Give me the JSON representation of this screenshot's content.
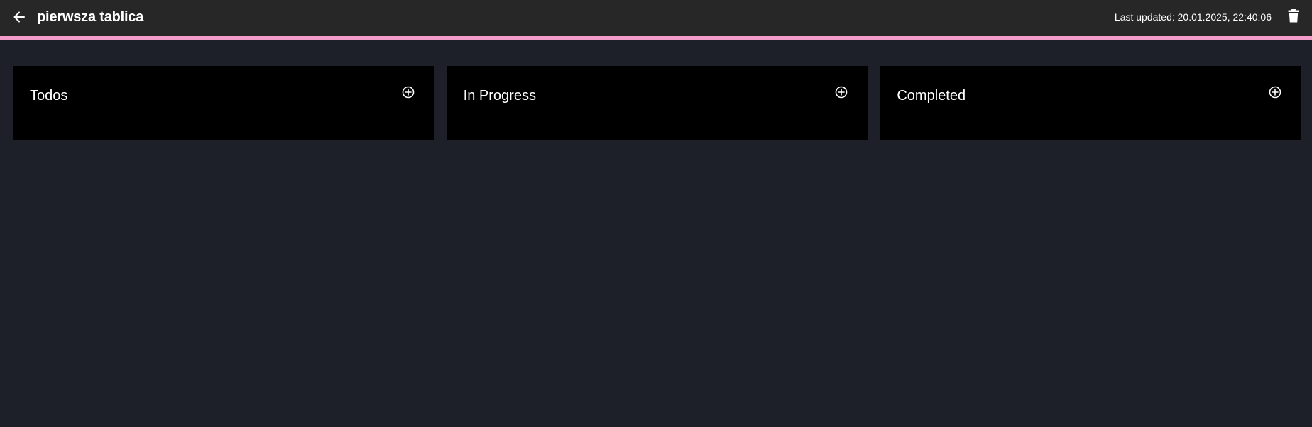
{
  "header": {
    "back_icon": "arrow-left-icon",
    "title": "pierwsza tablica",
    "last_updated": "Last updated: 20.01.2025, 22:40:06",
    "delete_icon": "trash-icon",
    "accent_color": "#f39cc9",
    "bar_color": "#272727"
  },
  "board": {
    "background": "#1d2029",
    "column_background": "#000000",
    "columns": [
      {
        "title": "Todos",
        "add_icon": "plus-circle-icon"
      },
      {
        "title": "In Progress",
        "add_icon": "plus-circle-icon"
      },
      {
        "title": "Completed",
        "add_icon": "plus-circle-icon"
      }
    ]
  }
}
